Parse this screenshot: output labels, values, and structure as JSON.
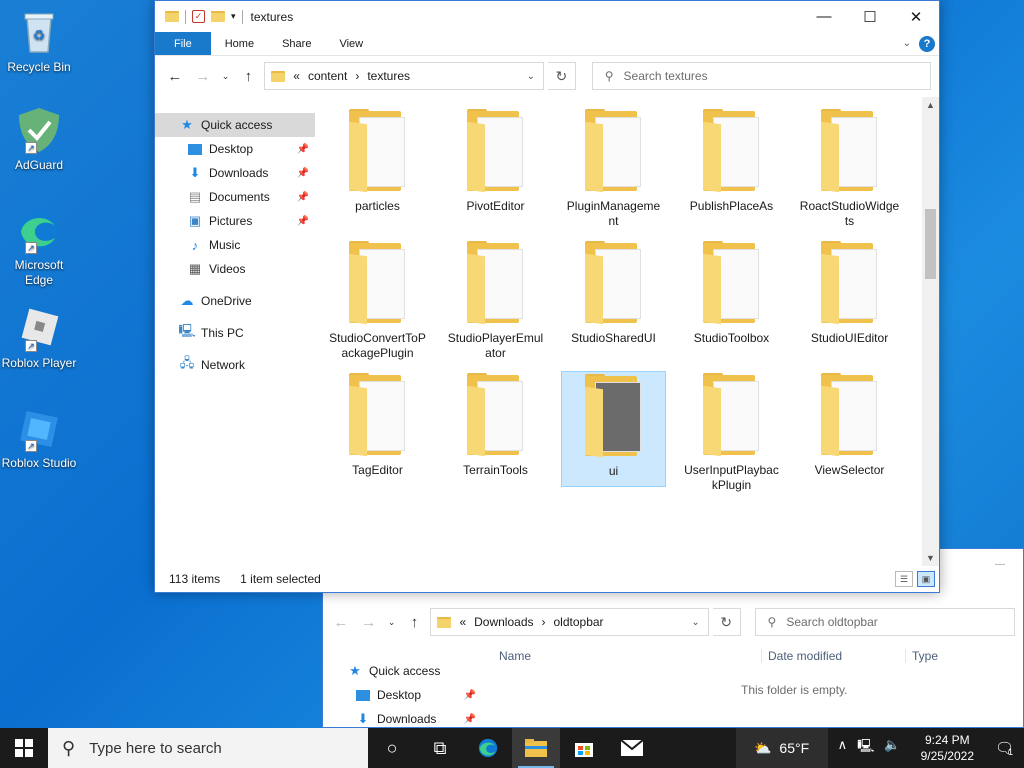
{
  "desktop": {
    "icons": [
      {
        "label": "Recycle Bin",
        "icon": "recycle-bin-icon"
      },
      {
        "label": "AdGuard",
        "icon": "adguard-icon"
      },
      {
        "label": "Microsoft Edge",
        "icon": "edge-icon"
      },
      {
        "label": "Roblox Player",
        "icon": "roblox-player-icon"
      },
      {
        "label": "Roblox Studio",
        "icon": "roblox-studio-icon"
      }
    ]
  },
  "explorer_main": {
    "title": "textures",
    "ribbon": {
      "file": "File",
      "home": "Home",
      "share": "Share",
      "view": "View"
    },
    "address": {
      "prefix": "«",
      "crumb1": "content",
      "crumb2": "textures"
    },
    "search_placeholder": "Search textures",
    "nav": {
      "quick_access": "Quick access",
      "desktop": "Desktop",
      "downloads": "Downloads",
      "documents": "Documents",
      "pictures": "Pictures",
      "music": "Music",
      "videos": "Videos",
      "onedrive": "OneDrive",
      "this_pc": "This PC",
      "network": "Network"
    },
    "folders": [
      {
        "name": "particles"
      },
      {
        "name": "PivotEditor"
      },
      {
        "name": "PluginManagement"
      },
      {
        "name": "PublishPlaceAs"
      },
      {
        "name": "RoactStudioWidgets"
      },
      {
        "name": "StudioConvertToPackagePlugin"
      },
      {
        "name": "StudioPlayerEmulator"
      },
      {
        "name": "StudioSharedUI"
      },
      {
        "name": "StudioToolbox"
      },
      {
        "name": "StudioUIEditor"
      },
      {
        "name": "TagEditor"
      },
      {
        "name": "TerrainTools"
      },
      {
        "name": "ui",
        "selected": true
      },
      {
        "name": "UserInputPlaybackPlugin"
      },
      {
        "name": "ViewSelector"
      }
    ],
    "status": {
      "items": "113 items",
      "selected": "1 item selected"
    }
  },
  "explorer_back": {
    "address": {
      "prefix": "«",
      "crumb1": "Downloads",
      "crumb2": "oldtopbar"
    },
    "search_placeholder": "Search oldtopbar",
    "columns": {
      "name": "Name",
      "date": "Date modified",
      "type": "Type"
    },
    "empty_message": "This folder is empty.",
    "nav": {
      "quick_access": "Quick access",
      "desktop": "Desktop",
      "downloads": "Downloads"
    }
  },
  "taskbar": {
    "search_placeholder": "Type here to search",
    "weather": "65°F",
    "time": "9:24 PM",
    "date": "9/25/2022",
    "notifications": "1"
  },
  "colors": {
    "accent": "#1979ca",
    "selection": "#cce8ff",
    "folder": "#f0c14b"
  }
}
